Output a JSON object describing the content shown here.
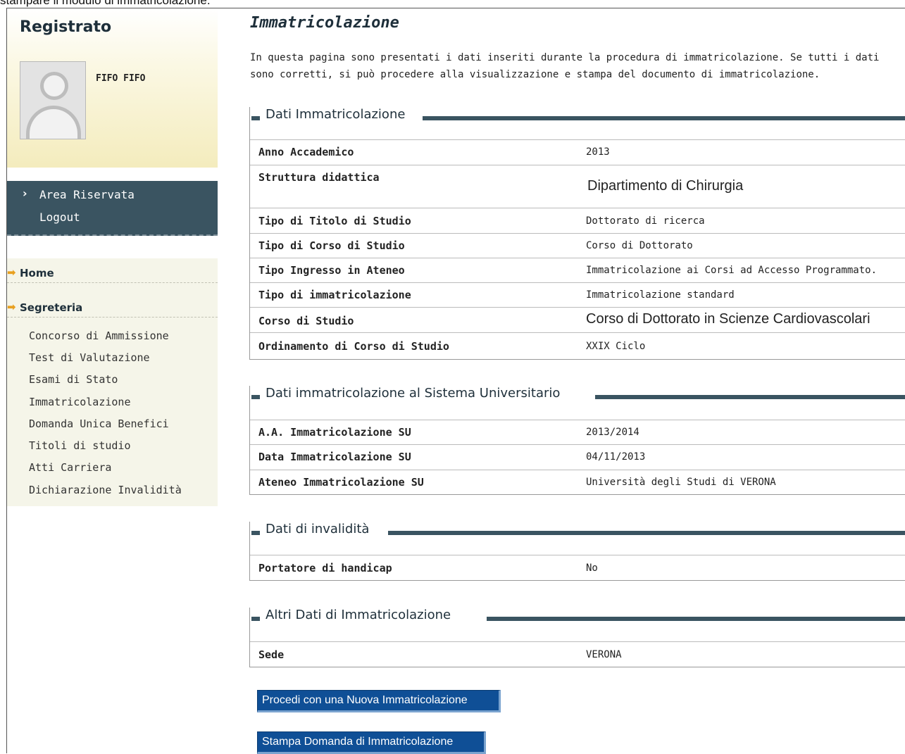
{
  "caption": "stampare il modulo di immatricolazione.",
  "sidebar": {
    "title": "Registrato",
    "user_name": "FIFO FIFO",
    "avatar_icon": "user-silhouette-icon",
    "reserved_menu": [
      {
        "label": "Area Riservata",
        "icon": "chevron-right-icon"
      },
      {
        "label": "Logout"
      }
    ],
    "nav_sections": [
      {
        "label": "Home",
        "icon": "arrow-right-icon"
      },
      {
        "label": "Segreteria",
        "icon": "arrow-right-icon"
      }
    ],
    "segreteria_links": [
      "Concorso di Ammissione",
      "Test di Valutazione",
      "Esami di Stato",
      "Immatricolazione",
      "Domanda Unica Benefici",
      "Titoli di studio",
      "Atti Carriera",
      "Dichiarazione Invalidità"
    ]
  },
  "main": {
    "title": "Immatricolazione",
    "intro": "In questa pagina sono presentati i dati inseriti durante la procedura di immatricolazione. Se tutti i dati sono corretti, si può procedere alla visualizzazione e stampa del documento di immatricolazione.",
    "sections": [
      {
        "legend": "Dati Immatricolazione",
        "rows": [
          {
            "label": "Anno Accademico",
            "value": "2013"
          },
          {
            "label": "Struttura didattica",
            "value": "Dipartimento di Chirurgia"
          },
          {
            "label": "Tipo di Titolo di Studio",
            "value": "Dottorato di ricerca"
          },
          {
            "label": "Tipo di Corso di Studio",
            "value": "Corso di Dottorato"
          },
          {
            "label": "Tipo Ingresso in Ateneo",
            "value": "Immatricolazione ai Corsi ad Accesso Programmato."
          },
          {
            "label": "Tipo di immatricolazione",
            "value": "Immatricolazione standard"
          },
          {
            "label": "Corso di Studio",
            "value": "Corso di Dottorato in Scienze Cardiovascolari"
          },
          {
            "label": "Ordinamento di Corso di Studio",
            "value": "XXIX Ciclo"
          }
        ]
      },
      {
        "legend": "Dati immatricolazione al Sistema Universitario",
        "rows": [
          {
            "label": "A.A. Immatricolazione SU",
            "value": "2013/2014"
          },
          {
            "label": "Data Immatricolazione SU",
            "value": "04/11/2013"
          },
          {
            "label": "Ateneo Immatricolazione SU",
            "value": "Università degli Studi di VERONA"
          }
        ]
      },
      {
        "legend": "Dati di invalidità",
        "rows": [
          {
            "label": "Portatore di handicap",
            "value": "No"
          }
        ]
      },
      {
        "legend": "Altri Dati di Immatricolazione",
        "rows": [
          {
            "label": "Sede",
            "value": "VERONA"
          }
        ]
      }
    ],
    "buttons": {
      "new_enrollment": "Procedi con una Nuova Immatricolazione",
      "print_application": "Stampa Domanda di Immatricolazione"
    }
  },
  "colors": {
    "sidebar_dark": "#3a5461",
    "button_blue": "#0f4f96",
    "nav_arrow": "#e8a020",
    "title_color": "#1e2f3a"
  }
}
